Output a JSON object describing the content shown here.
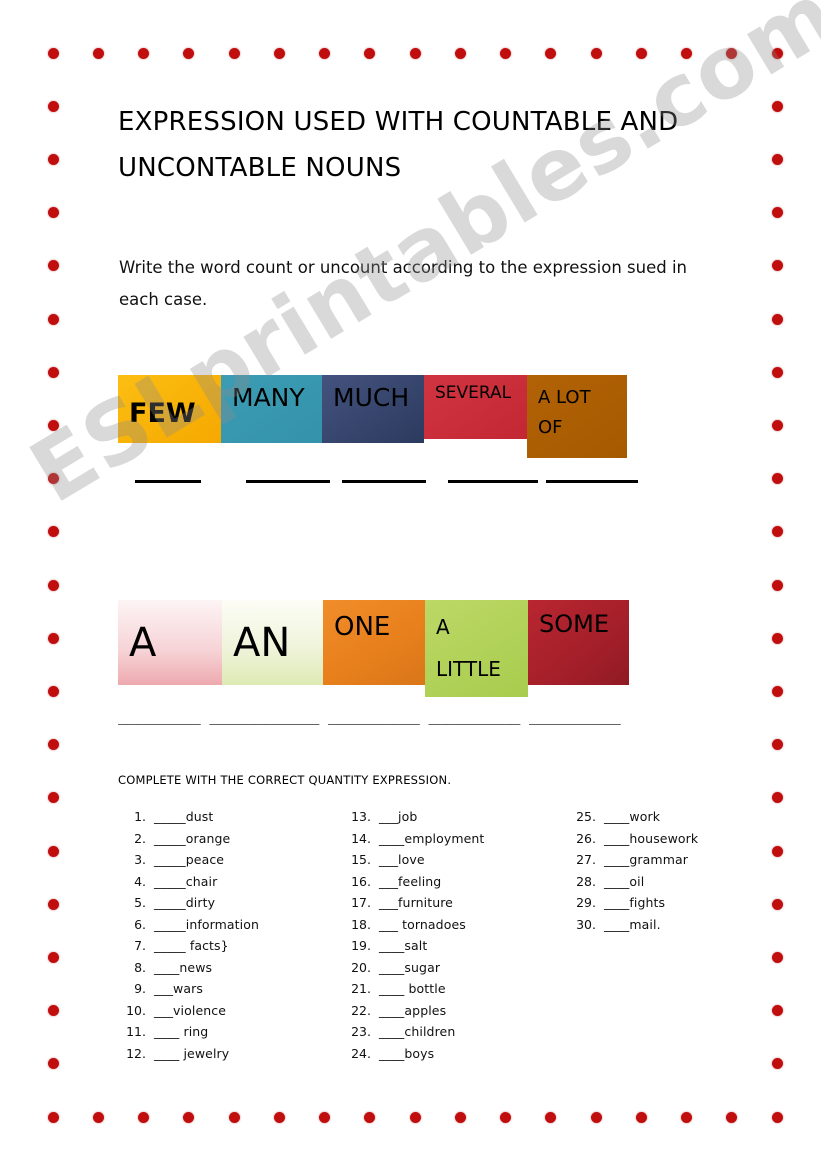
{
  "document": {
    "title": "EXPRESSION USED WITH COUNTABLE AND UNCONTABLE NOUNS",
    "instruction": "Write the word count or uncount according to the expression sued in each case.",
    "watermark": "ESLprintables.com",
    "complete_heading": "COMPLETE WITH THE CORRECT QUANTITY EXPRESSION."
  },
  "row1": {
    "boxes": [
      {
        "label": "FEW",
        "color": "#f5a800"
      },
      {
        "label": "MANY",
        "color": "#3493ab"
      },
      {
        "label": "MUCH",
        "color": "#2c3a5f"
      },
      {
        "label": "SEVERAL",
        "color": "#c42734"
      },
      {
        "label": "A LOT OF",
        "color": "#a65a00"
      }
    ]
  },
  "row2": {
    "boxes": [
      {
        "label": "A",
        "color": "#eda9ae"
      },
      {
        "label": "AN",
        "color": "#ddeab4"
      },
      {
        "label": "ONE",
        "color": "#e8801c"
      },
      {
        "label": "A LITTLE",
        "color": "#a8cc4d"
      },
      {
        "label": "SOME",
        "color": "#a01e28"
      }
    ]
  },
  "blanks": {
    "row2_line": "_________ ____________ __________ __________  __________"
  },
  "questions": {
    "column1": [
      {
        "num": "1.",
        "text": "_____dust"
      },
      {
        "num": "2.",
        "text": "_____orange"
      },
      {
        "num": "3.",
        "text": "_____peace"
      },
      {
        "num": "4.",
        "text": "_____chair"
      },
      {
        "num": "5.",
        "text": "_____dirty"
      },
      {
        "num": "6.",
        "text": "_____information"
      },
      {
        "num": "7.",
        "text": "_____ facts}"
      },
      {
        "num": "8.",
        "text": "____news"
      },
      {
        "num": "9.",
        "text": "___wars"
      },
      {
        "num": "10.",
        "text": "___violence"
      },
      {
        "num": "11.",
        "text": "____ ring"
      },
      {
        "num": "12.",
        "text": "____ jewelry"
      }
    ],
    "column2": [
      {
        "num": "13.",
        "text": "___job"
      },
      {
        "num": "14.",
        "text": "____employment"
      },
      {
        "num": "15.",
        "text": "___love"
      },
      {
        "num": "16.",
        "text": "___feeling"
      },
      {
        "num": "17.",
        "text": "___furniture"
      },
      {
        "num": "18.",
        "text": "___ tornadoes"
      },
      {
        "num": "19.",
        "text": "____salt"
      },
      {
        "num": "20.",
        "text": "____sugar"
      },
      {
        "num": "21.",
        "text": "____ bottle"
      },
      {
        "num": "22.",
        "text": "____apples"
      },
      {
        "num": "23.",
        "text": "____children"
      },
      {
        "num": "24.",
        "text": "____boys"
      }
    ],
    "column3": [
      {
        "num": "25.",
        "text": "____work"
      },
      {
        "num": "26.",
        "text": "____housework"
      },
      {
        "num": "27.",
        "text": "____grammar"
      },
      {
        "num": "28.",
        "text": "____oil"
      },
      {
        "num": "29.",
        "text": "____fights"
      },
      {
        "num": "30.",
        "text": "____mail."
      }
    ]
  }
}
